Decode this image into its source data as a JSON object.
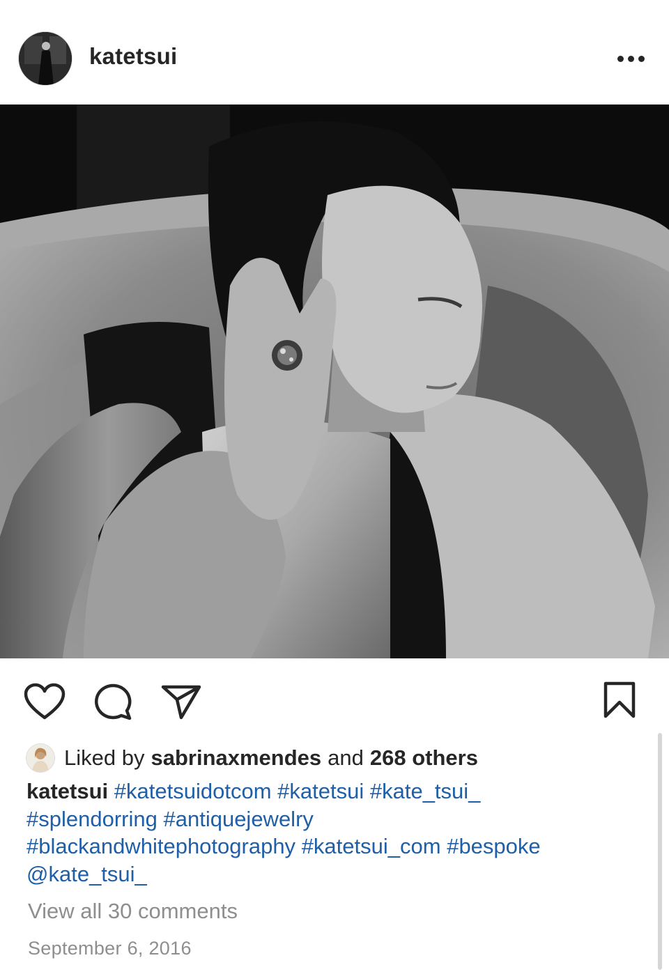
{
  "post": {
    "username": "katetsui",
    "more_icon": "more-horizontal-icon",
    "photo_alt": "black-and-white portrait in bathtub",
    "actions": {
      "like_icon": "heart-icon",
      "comment_icon": "comment-icon",
      "share_icon": "paper-plane-icon",
      "save_icon": "bookmark-icon"
    },
    "likes": {
      "prefix": "Liked by",
      "user": "sabrinaxmendes",
      "joiner": "and",
      "others": "268 others"
    },
    "caption": {
      "user": "katetsui",
      "tags": [
        "#katetsuidotcom",
        "#katetsui",
        "#kate_tsui_",
        "#splendorring",
        "#antiquejewelry",
        "#blackandwhitephotography",
        "#katetsui_com",
        "#bespoke",
        "@kate_tsui_"
      ]
    },
    "view_comments": "View all 30 comments",
    "date": "September 6, 2016"
  },
  "colors": {
    "text": "#262626",
    "link": "#1f5fa8",
    "muted": "#8e8e8e",
    "background": "#ffffff"
  }
}
